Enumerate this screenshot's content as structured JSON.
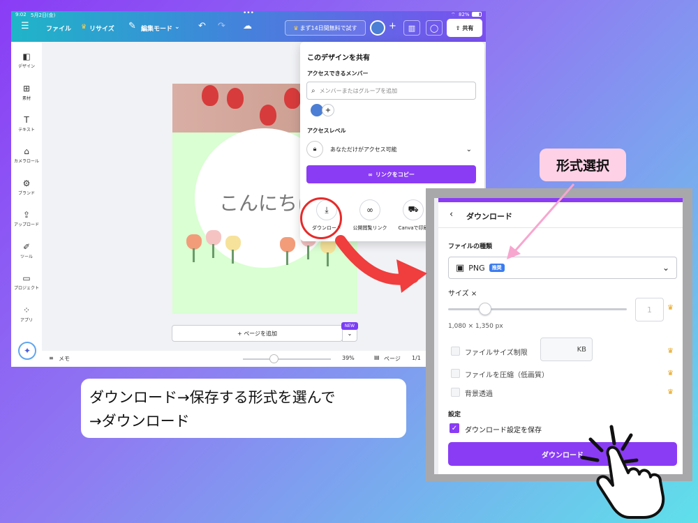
{
  "status_bar": {
    "time": "9:02",
    "date": "5月2日(金)",
    "battery": "82%"
  },
  "topbar": {
    "file": "ファイル",
    "resize": "リサイズ",
    "edit_mode": "編集モード",
    "trial": "まず14日間無料で試す",
    "share": "共有"
  },
  "sidebar": {
    "items": [
      {
        "label": "デザイン",
        "icon": "layout-icon"
      },
      {
        "label": "素材",
        "icon": "elements-icon"
      },
      {
        "label": "テキスト",
        "icon": "text-icon"
      },
      {
        "label": "カメラロール",
        "icon": "camera-icon"
      },
      {
        "label": "ブランド",
        "icon": "brand-icon"
      },
      {
        "label": "アップロード",
        "icon": "upload-icon"
      },
      {
        "label": "ツール",
        "icon": "tools-icon"
      },
      {
        "label": "プロジェクト",
        "icon": "folder-icon"
      },
      {
        "label": "アプリ",
        "icon": "apps-icon"
      }
    ]
  },
  "canvas": {
    "greeting": "こんにちは",
    "add_page": "+ ページを追加",
    "new_badge": "NEW"
  },
  "bottombar": {
    "memo": "メモ",
    "zoom": "39%",
    "pages": "ページ",
    "page_count": "1/1"
  },
  "share_panel": {
    "title": "このデザインを共有",
    "members_heading": "アクセスできるメンバー",
    "search_placeholder": "メンバーまたはグループを追加",
    "access_heading": "アクセスレベル",
    "access_value": "あなただけがアクセス可能",
    "copy_link": "リンクをコピー",
    "options": [
      {
        "label": "ダウンロード",
        "icon": "download-icon"
      },
      {
        "label": "公開閲覧リンク",
        "icon": "link-icon"
      },
      {
        "label": "Canvaで印刷",
        "icon": "truck-icon"
      }
    ]
  },
  "caption": {
    "line1": "ダウンロード→保存する形式を選んで",
    "line2": "→ダウンロード"
  },
  "keyword_badge": "形式選択",
  "download_panel": {
    "title": "ダウンロード",
    "file_type_heading": "ファイルの種類",
    "file_type": "PNG",
    "recommended": "推奨",
    "size_heading": "サイズ ×",
    "size_value": "1",
    "dimensions": "1,080 × 1,350 px",
    "file_size_limit": "ファイルサイズ制限",
    "kb_unit": "KB",
    "compress": "ファイルを圧縮（低画質）",
    "transparent": "背景透過",
    "settings_heading": "設定",
    "save_settings": "ダウンロード設定を保存",
    "download_button": "ダウンロード"
  },
  "colors": {
    "accent": "#8a3cf5",
    "highlight_ring": "#e62a2a",
    "arrow": "#f03d3d",
    "badge_bg": "#ffd1e6"
  }
}
